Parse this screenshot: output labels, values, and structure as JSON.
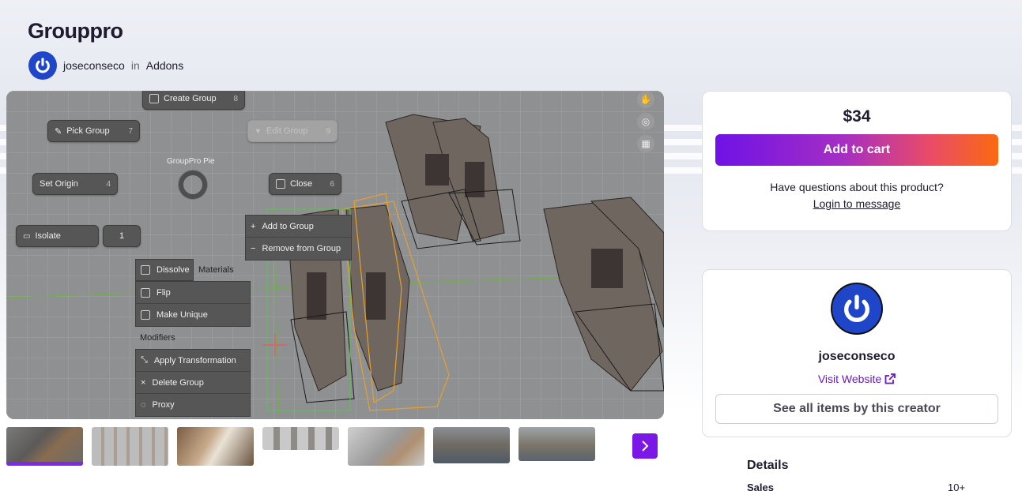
{
  "product": {
    "title": "Grouppro",
    "author": "joseconseco",
    "in_word": "in",
    "category": "Addons"
  },
  "viewer": {
    "pie_buttons": {
      "create_group": {
        "label": "Create Group",
        "num": "8"
      },
      "pick_group": {
        "label": "Pick Group",
        "num": "7"
      },
      "edit_group": {
        "label": "Edit Group",
        "num": "9"
      },
      "set_origin": {
        "label": "Set Origin",
        "num": "4"
      },
      "close": {
        "label": "Close",
        "num": "6"
      },
      "isolate": {
        "label": "Isolate",
        "num": "1"
      }
    },
    "pie_title": "GroupPro Pie",
    "group_menu": [
      "Add to Group",
      "Remove from Group"
    ],
    "tabs": [
      "Dissolve",
      "Materials"
    ],
    "ops_menu": [
      "Flip",
      "Make Unique"
    ],
    "modifiers_label": "Modifiers",
    "ops_menu2": [
      "Apply Transformation",
      "Delete Group",
      "Proxy"
    ]
  },
  "thumbnails": 7,
  "purchase": {
    "price": "$34",
    "add_to_cart": "Add to cart",
    "question": "Have questions about this product?",
    "login": "Login to message"
  },
  "creator": {
    "name": "joseconseco",
    "visit": "Visit Website",
    "see_all": "See all items by this creator"
  },
  "details": {
    "heading": "Details",
    "sales_label": "Sales",
    "sales_value": "10+"
  },
  "colors": {
    "accent": "#7c18e6",
    "avatar": "#1f46c8"
  }
}
